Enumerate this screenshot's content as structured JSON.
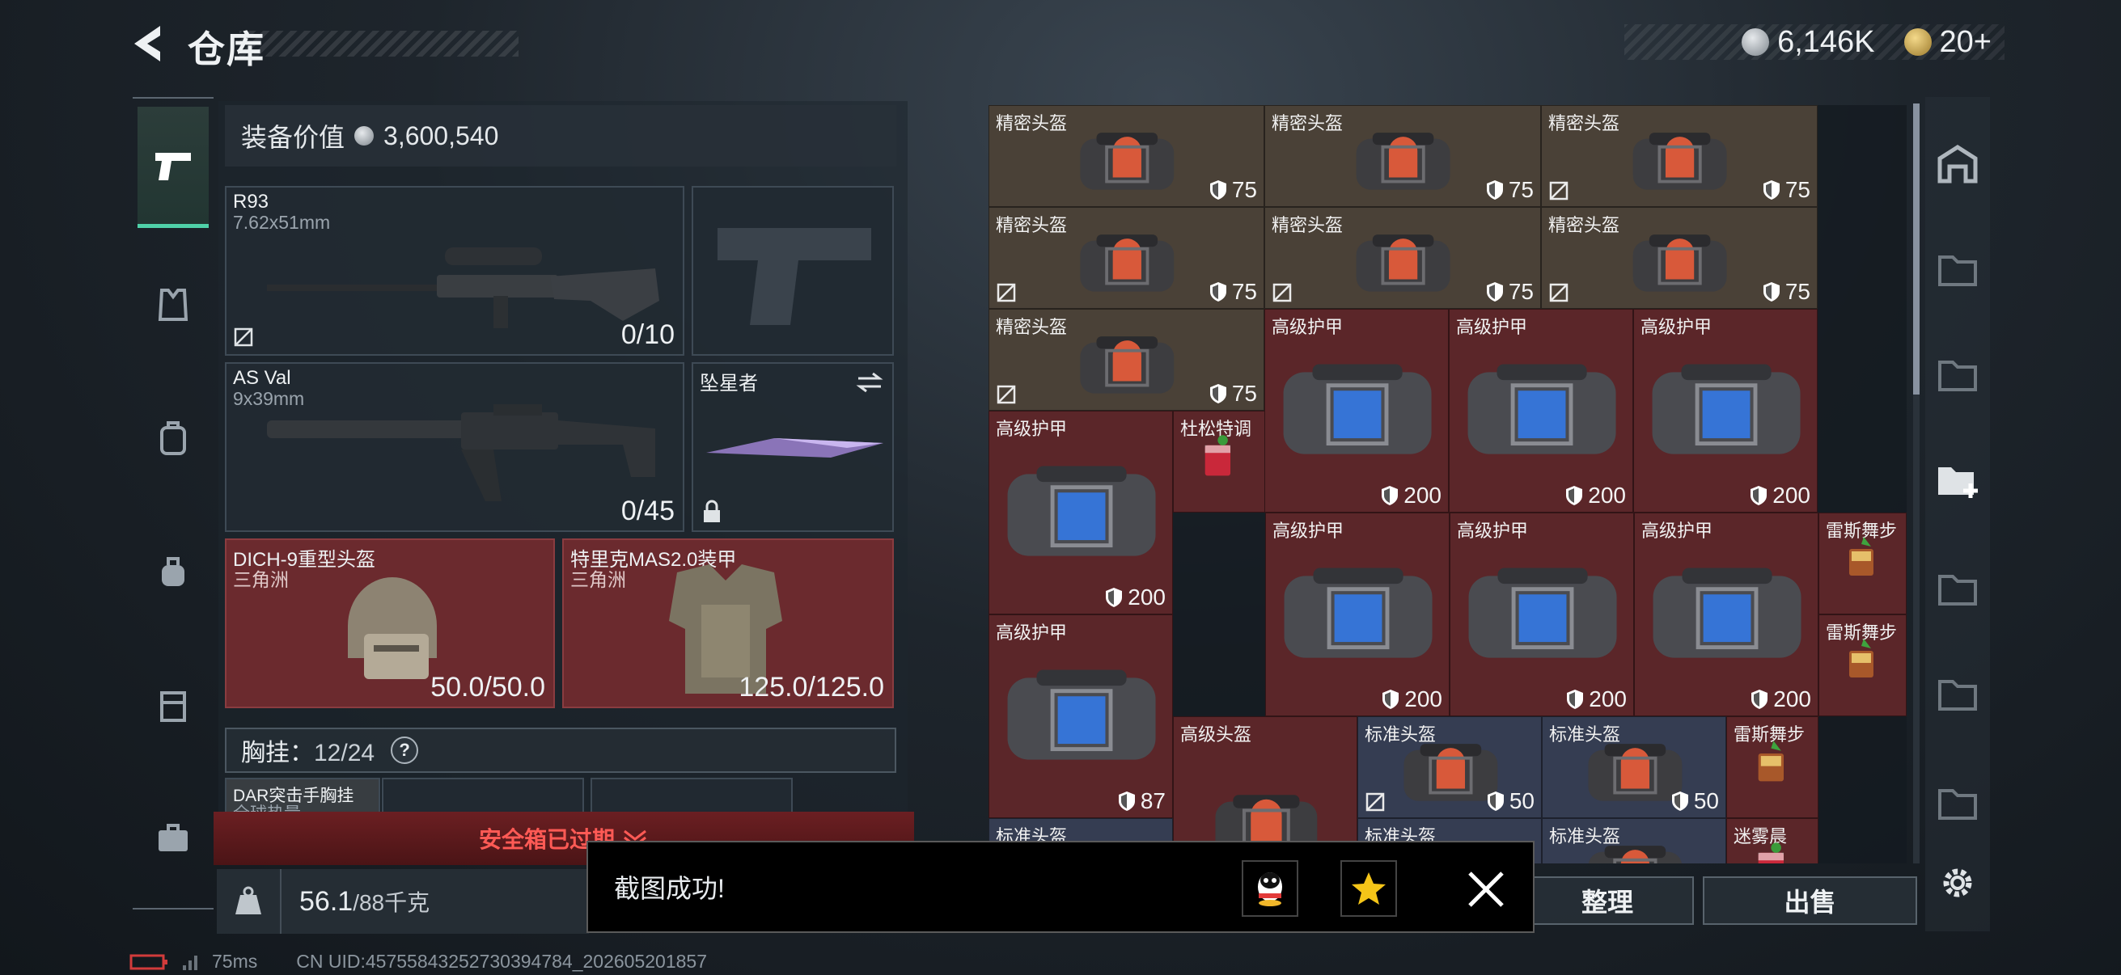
{
  "header": {
    "title": "仓库",
    "currency_silver": "6,146K",
    "currency_gold": "20+"
  },
  "equipment": {
    "value_label": "装备价值",
    "value": "3,600,540",
    "primary": {
      "name": "R93",
      "caliber": "7.62x51mm",
      "ammo": "0/10"
    },
    "secondary": {
      "name": "AS Val",
      "caliber": "9x39mm",
      "ammo": "0/45"
    },
    "melee": {
      "name": "坠星者"
    },
    "helmet": {
      "name": "DICH-9重型头盔",
      "origin": "三角洲",
      "durability": "50.0/50.0"
    },
    "armor": {
      "name": "特里克MAS2.0装甲",
      "origin": "三角洲",
      "durability": "125.0/125.0"
    },
    "chest_rig": {
      "label": "胸挂：",
      "capacity": "12/24",
      "help": "?"
    },
    "rig_item": {
      "name": "DAR突击手胸挂",
      "origin": "全球热量"
    },
    "safebox_expired": "安全箱已过期",
    "weight": "56.1",
    "weight_max": "/88千克"
  },
  "inventory": [
    {
      "name": "精密头盔",
      "value": "75",
      "type": "helmet",
      "color": "gray",
      "nosell": false
    },
    {
      "name": "精密头盔",
      "value": "75",
      "type": "helmet",
      "color": "gray",
      "nosell": false
    },
    {
      "name": "精密头盔",
      "value": "75",
      "type": "helmet",
      "color": "gray",
      "nosell": true
    },
    {
      "name": "精密头盔",
      "value": "75",
      "type": "helmet",
      "color": "gray",
      "nosell": true
    },
    {
      "name": "精密头盔",
      "value": "75",
      "type": "helmet",
      "color": "gray",
      "nosell": true
    },
    {
      "name": "精密头盔",
      "value": "75",
      "type": "helmet",
      "color": "gray",
      "nosell": true
    },
    {
      "name": "精密头盔",
      "value": "75",
      "type": "helmet",
      "color": "gray",
      "nosell": true
    },
    {
      "name": "高级护甲",
      "value": "200",
      "type": "armor",
      "color": "red",
      "nosell": false
    },
    {
      "name": "高级护甲",
      "value": "200",
      "type": "armor",
      "color": "red",
      "nosell": false
    },
    {
      "name": "高级护甲",
      "value": "200",
      "type": "armor",
      "color": "red",
      "nosell": false
    },
    {
      "name": "高级护甲",
      "value": "200",
      "type": "armor",
      "color": "red",
      "nosell": false
    },
    {
      "name": "杜松特调",
      "value": "",
      "type": "drink",
      "color": "red",
      "nosell": false
    },
    {
      "name": "高级护甲",
      "value": "200",
      "type": "armor",
      "color": "red",
      "nosell": false
    },
    {
      "name": "高级护甲",
      "value": "200",
      "type": "armor",
      "color": "red",
      "nosell": false
    },
    {
      "name": "高级护甲",
      "value": "200",
      "type": "armor",
      "color": "red",
      "nosell": false
    },
    {
      "name": "雷斯舞步",
      "value": "",
      "type": "drink2",
      "color": "red",
      "nosell": false
    },
    {
      "name": "高级护甲",
      "value": "87",
      "type": "armor",
      "color": "red",
      "nosell": false
    },
    {
      "name": "雷斯舞步",
      "value": "",
      "type": "drink2",
      "color": "red",
      "nosell": false
    },
    {
      "name": "高级头盔",
      "value": "",
      "type": "helmet",
      "color": "red",
      "nosell": false
    },
    {
      "name": "标准头盔",
      "value": "50",
      "type": "helmet",
      "color": "blue",
      "nosell": true
    },
    {
      "name": "标准头盔",
      "value": "50",
      "type": "helmet",
      "color": "blue",
      "nosell": false
    },
    {
      "name": "雷斯舞步",
      "value": "",
      "type": "drink2",
      "color": "red",
      "nosell": false
    },
    {
      "name": "标准头盔",
      "value": "",
      "type": "helmet",
      "color": "blue",
      "nosell": false
    },
    {
      "name": "标准头盔",
      "value": "",
      "type": "helmet",
      "color": "blue",
      "nosell": false
    },
    {
      "name": "标准头盔",
      "value": "",
      "type": "helmet",
      "color": "blue",
      "nosell": false
    },
    {
      "name": "迷雾晨",
      "value": "",
      "type": "drink",
      "color": "red",
      "nosell": false
    }
  ],
  "buttons": {
    "sort": "整理",
    "sell": "出售"
  },
  "toast": {
    "message": "截图成功!"
  },
  "status": {
    "ping": "75ms",
    "uid": "CN UID:4575584325273039478​4_202605201857"
  },
  "colors": {
    "accent": "#4fd1a8",
    "red_cell": "#5b2629",
    "gray_cell": "#4a4137",
    "blue_cell": "#353d52",
    "warning": "#ff5a55"
  }
}
